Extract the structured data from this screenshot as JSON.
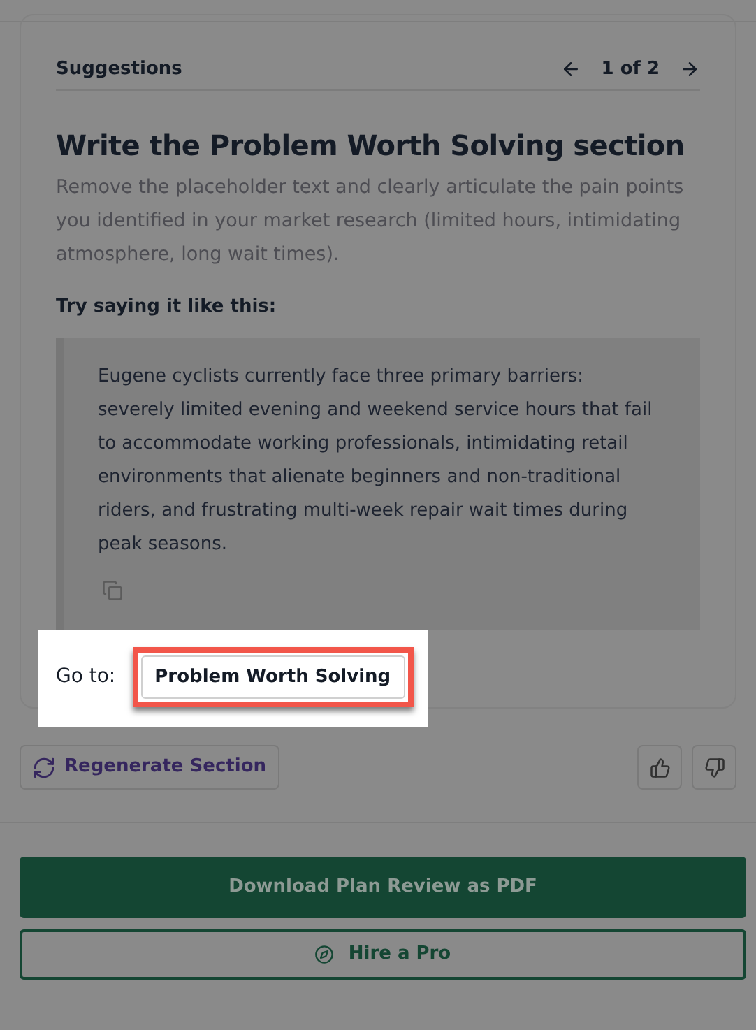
{
  "suggestions": {
    "title": "Suggestions",
    "pager": "1 of 2",
    "heading": "Write the Problem Worth Solving section",
    "description": "Remove the placeholder text and clearly articulate the pain points you identified in your market research (limited hours, intimidating atmosphere, long wait times).",
    "example_label": "Try saying it like this:",
    "example_text": "Eugene cyclists currently face three primary barriers: severely limited evening and weekend service hours that fail to accommodate working professionals, intimidating retail environments that alienate beginners and non-traditional riders, and frustrating multi-week repair wait times during peak seasons.",
    "goto_label": "Go to:",
    "goto_button": {
      "label": "Problem Worth Solving",
      "highlighted": true
    }
  },
  "regenerate_button": "Regenerate Section",
  "download_button": "Download Plan Review as PDF",
  "hire_button": "Hire a Pro"
}
